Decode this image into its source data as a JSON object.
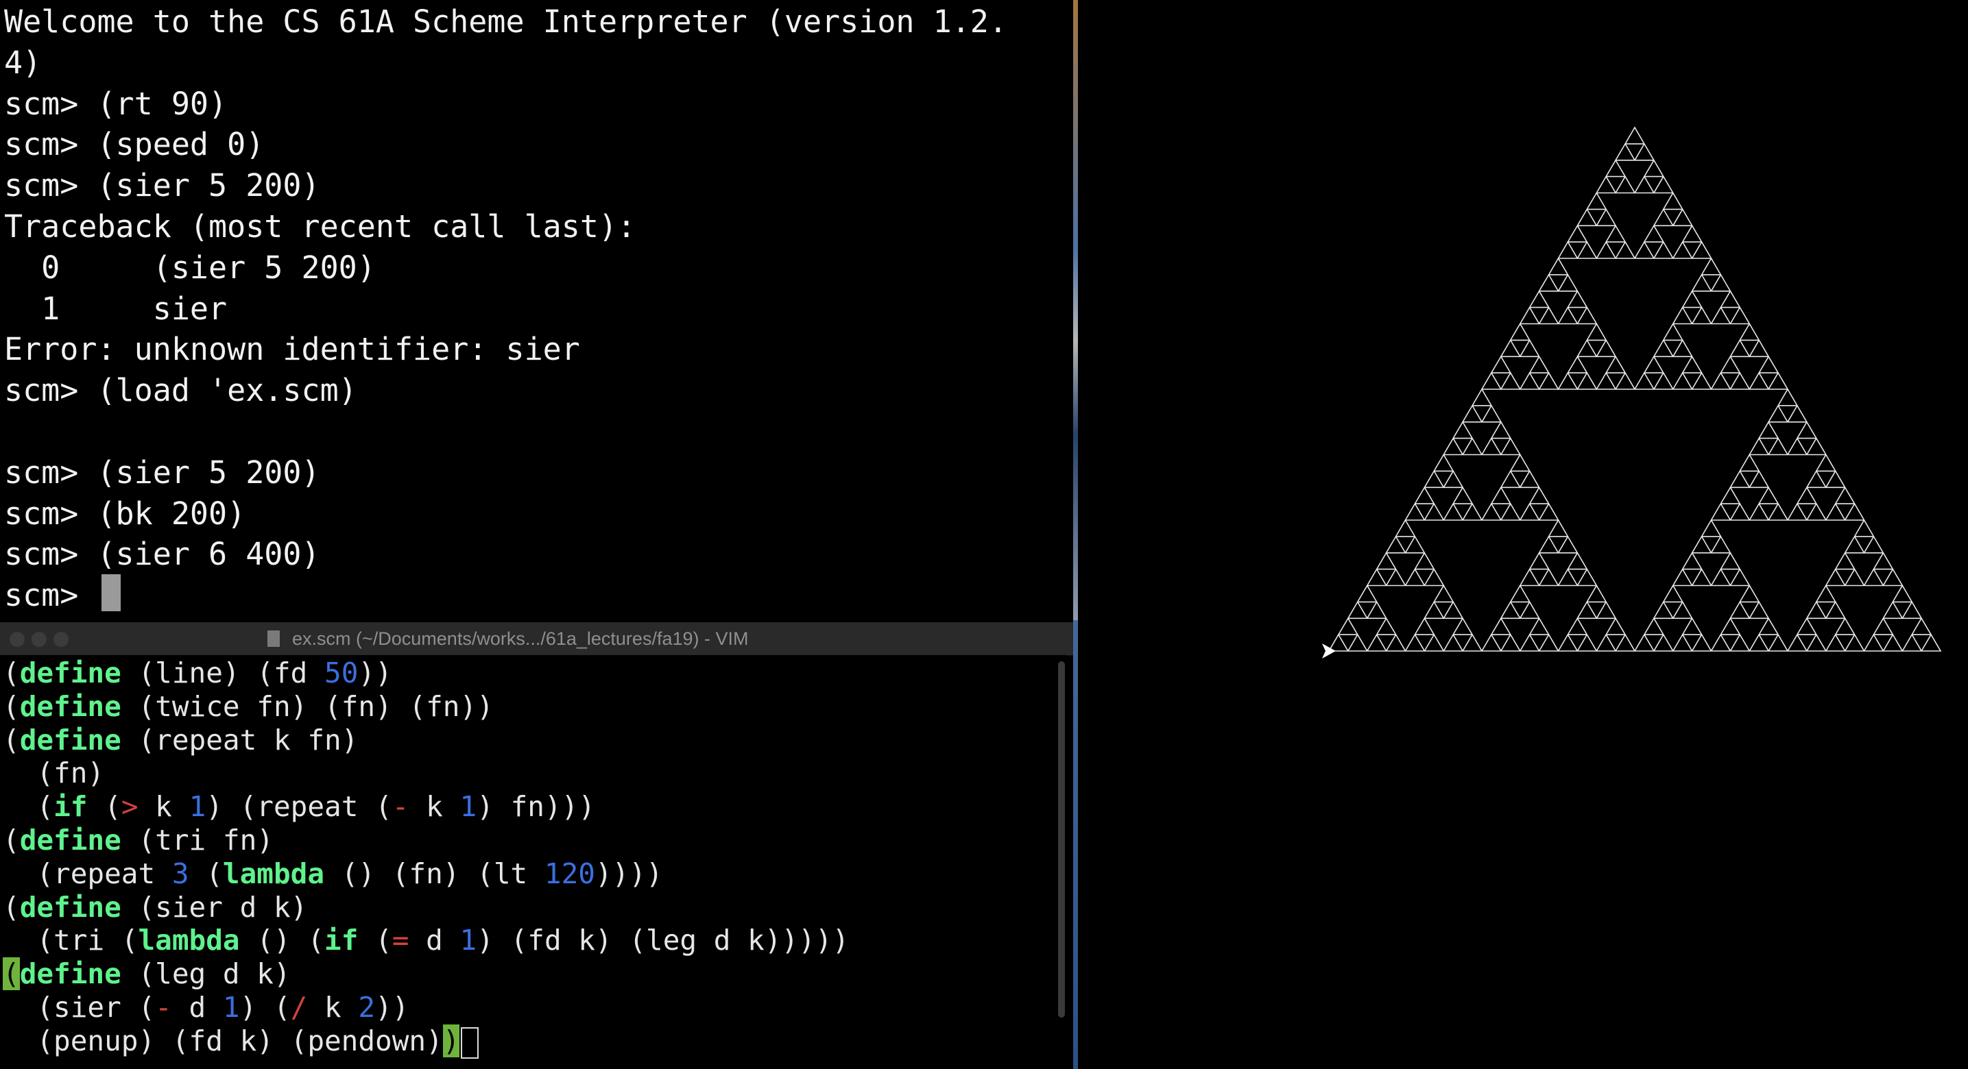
{
  "terminal": {
    "lines": [
      "Welcome to the CS 61A Scheme Interpreter (version 1.2.",
      "4)",
      "scm> (rt 90)",
      "scm> (speed 0)",
      "scm> (sier 5 200)",
      "Traceback (most recent call last):",
      "  0     (sier 5 200)",
      "  1     sier",
      "Error: unknown identifier: sier",
      "scm> (load 'ex.scm)",
      "",
      "scm> (sier 5 200)",
      "scm> (bk 200)",
      "scm> (sier 6 400)",
      "scm> "
    ]
  },
  "vim": {
    "title": "ex.scm (~/Documents/works.../61a_lectures/fa19) - VIM",
    "code": [
      [
        {
          "t": "(",
          "c": ""
        },
        {
          "t": "define",
          "c": "kw"
        },
        {
          "t": " (line) (fd ",
          "c": ""
        },
        {
          "t": "50",
          "c": "num"
        },
        {
          "t": "))",
          "c": ""
        }
      ],
      [
        {
          "t": "(",
          "c": ""
        },
        {
          "t": "define",
          "c": "kw"
        },
        {
          "t": " (twice fn) (fn) (fn))",
          "c": ""
        }
      ],
      [
        {
          "t": "(",
          "c": ""
        },
        {
          "t": "define",
          "c": "kw"
        },
        {
          "t": " (repeat k fn)",
          "c": ""
        }
      ],
      [
        {
          "t": "  (fn)",
          "c": ""
        }
      ],
      [
        {
          "t": "  (",
          "c": ""
        },
        {
          "t": "if",
          "c": "kw"
        },
        {
          "t": " (",
          "c": ""
        },
        {
          "t": ">",
          "c": "op"
        },
        {
          "t": " k ",
          "c": ""
        },
        {
          "t": "1",
          "c": "num"
        },
        {
          "t": ") (repeat (",
          "c": ""
        },
        {
          "t": "-",
          "c": "op"
        },
        {
          "t": " k ",
          "c": ""
        },
        {
          "t": "1",
          "c": "num"
        },
        {
          "t": ") fn)))",
          "c": ""
        }
      ],
      [
        {
          "t": "(",
          "c": ""
        },
        {
          "t": "define",
          "c": "kw"
        },
        {
          "t": " (tri fn)",
          "c": ""
        }
      ],
      [
        {
          "t": "  (repeat ",
          "c": ""
        },
        {
          "t": "3",
          "c": "num"
        },
        {
          "t": " (",
          "c": ""
        },
        {
          "t": "lambda",
          "c": "kw"
        },
        {
          "t": " () (fn) (lt ",
          "c": ""
        },
        {
          "t": "120",
          "c": "num"
        },
        {
          "t": "))))",
          "c": ""
        }
      ],
      [
        {
          "t": "(",
          "c": ""
        },
        {
          "t": "define",
          "c": "kw"
        },
        {
          "t": " (sier d k)",
          "c": ""
        }
      ],
      [
        {
          "t": "  (tri (",
          "c": ""
        },
        {
          "t": "lambda",
          "c": "kw"
        },
        {
          "t": " () (",
          "c": ""
        },
        {
          "t": "if",
          "c": "kw"
        },
        {
          "t": " (",
          "c": ""
        },
        {
          "t": "=",
          "c": "op"
        },
        {
          "t": " d ",
          "c": ""
        },
        {
          "t": "1",
          "c": "num"
        },
        {
          "t": ") (fd k) (leg d k)))))",
          "c": ""
        }
      ],
      [
        {
          "t": "(",
          "c": "paren-hl"
        },
        {
          "t": "define",
          "c": "kw"
        },
        {
          "t": " (leg d k)",
          "c": ""
        }
      ],
      [
        {
          "t": "  (sier (",
          "c": ""
        },
        {
          "t": "-",
          "c": "op"
        },
        {
          "t": " d ",
          "c": ""
        },
        {
          "t": "1",
          "c": "num"
        },
        {
          "t": ") (",
          "c": ""
        },
        {
          "t": "/",
          "c": "op"
        },
        {
          "t": " k ",
          "c": ""
        },
        {
          "t": "2",
          "c": "num"
        },
        {
          "t": "))",
          "c": ""
        }
      ],
      [
        {
          "t": "  (penup) (fd k) (pendown)",
          "c": ""
        },
        {
          "t": ")",
          "c": "paren-hl"
        }
      ]
    ]
  },
  "turtle": {
    "stroke_color": "#e8e8e8",
    "background": "#000000",
    "depth": 6
  },
  "colors": {
    "keyword": "#5ff28d",
    "number": "#3b6fe0",
    "operator": "#d2433b",
    "paren_match": "#6fb33d"
  }
}
